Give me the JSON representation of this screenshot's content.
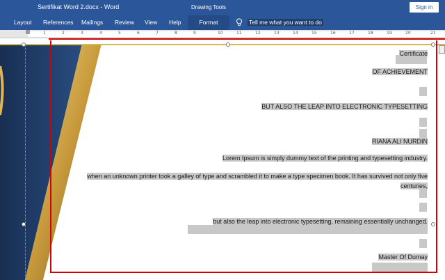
{
  "window": {
    "title": "Sertifikat Word 2.docx  -  Word",
    "context_group": "Drawing Tools",
    "signin": "Sign in"
  },
  "ribbon": {
    "tabs": [
      "Layout",
      "References",
      "Mailings",
      "Review",
      "View",
      "Help",
      "Format"
    ],
    "tellme": "Tell me what you want to do"
  },
  "ruler": {
    "numbers": [
      "1",
      "2",
      "3",
      "4",
      "5",
      "6",
      "7",
      "8",
      "9",
      "10",
      "11",
      "12",
      "13",
      "14",
      "15",
      "16",
      "17",
      "18",
      "19",
      "20",
      "21"
    ]
  },
  "document": {
    "lines": [
      "Certificate",
      "OF ACHIEVEMENT",
      "BUT ALSO THE LEAP INTO ELECTRONIC TYPESETTING",
      "RIANA ALI NURDIN",
      "Lorem Ipsum is simply dummy text of the printing and typesetting industry.",
      "when an unknown printer took a galley of type and scrambled it to make a type specimen book. It has survived not only five",
      "centuries,",
      "but also the leap into electronic typesetting, remaining essentially unchanged.",
      "Master Of Dumay"
    ]
  },
  "colors": {
    "ribbon": "#2b579a",
    "selection": "#c8c8c8",
    "frame": "#d40000",
    "gold": "#d7b94d",
    "navy": "#1f3a67"
  }
}
